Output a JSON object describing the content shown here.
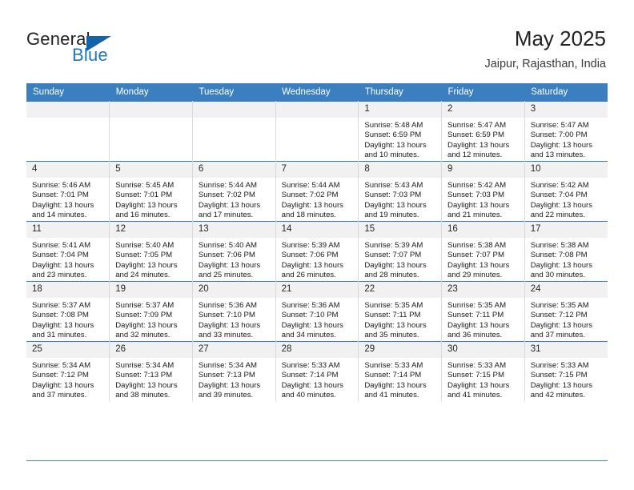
{
  "brand": {
    "name_top": "General",
    "name_bottom": "Blue",
    "accent_color": "#1263a8",
    "text_color": "#231f20"
  },
  "header": {
    "title": "May 2025",
    "subtitle": "Jaipur, Rajasthan, India"
  },
  "calendar": {
    "header_bg": "#3c7fc1",
    "header_text_color": "#ffffff",
    "daynum_bg": "#f1f1f1",
    "weekdays": [
      "Sunday",
      "Monday",
      "Tuesday",
      "Wednesday",
      "Thursday",
      "Friday",
      "Saturday"
    ],
    "weeks": [
      [
        {
          "day": "",
          "lines": []
        },
        {
          "day": "",
          "lines": []
        },
        {
          "day": "",
          "lines": []
        },
        {
          "day": "",
          "lines": []
        },
        {
          "day": "1",
          "lines": [
            "Sunrise: 5:48 AM",
            "Sunset: 6:59 PM",
            "Daylight: 13 hours and 10 minutes."
          ]
        },
        {
          "day": "2",
          "lines": [
            "Sunrise: 5:47 AM",
            "Sunset: 6:59 PM",
            "Daylight: 13 hours and 12 minutes."
          ]
        },
        {
          "day": "3",
          "lines": [
            "Sunrise: 5:47 AM",
            "Sunset: 7:00 PM",
            "Daylight: 13 hours and 13 minutes."
          ]
        }
      ],
      [
        {
          "day": "4",
          "lines": [
            "Sunrise: 5:46 AM",
            "Sunset: 7:01 PM",
            "Daylight: 13 hours and 14 minutes."
          ]
        },
        {
          "day": "5",
          "lines": [
            "Sunrise: 5:45 AM",
            "Sunset: 7:01 PM",
            "Daylight: 13 hours and 16 minutes."
          ]
        },
        {
          "day": "6",
          "lines": [
            "Sunrise: 5:44 AM",
            "Sunset: 7:02 PM",
            "Daylight: 13 hours and 17 minutes."
          ]
        },
        {
          "day": "7",
          "lines": [
            "Sunrise: 5:44 AM",
            "Sunset: 7:02 PM",
            "Daylight: 13 hours and 18 minutes."
          ]
        },
        {
          "day": "8",
          "lines": [
            "Sunrise: 5:43 AM",
            "Sunset: 7:03 PM",
            "Daylight: 13 hours and 19 minutes."
          ]
        },
        {
          "day": "9",
          "lines": [
            "Sunrise: 5:42 AM",
            "Sunset: 7:03 PM",
            "Daylight: 13 hours and 21 minutes."
          ]
        },
        {
          "day": "10",
          "lines": [
            "Sunrise: 5:42 AM",
            "Sunset: 7:04 PM",
            "Daylight: 13 hours and 22 minutes."
          ]
        }
      ],
      [
        {
          "day": "11",
          "lines": [
            "Sunrise: 5:41 AM",
            "Sunset: 7:04 PM",
            "Daylight: 13 hours and 23 minutes."
          ]
        },
        {
          "day": "12",
          "lines": [
            "Sunrise: 5:40 AM",
            "Sunset: 7:05 PM",
            "Daylight: 13 hours and 24 minutes."
          ]
        },
        {
          "day": "13",
          "lines": [
            "Sunrise: 5:40 AM",
            "Sunset: 7:06 PM",
            "Daylight: 13 hours and 25 minutes."
          ]
        },
        {
          "day": "14",
          "lines": [
            "Sunrise: 5:39 AM",
            "Sunset: 7:06 PM",
            "Daylight: 13 hours and 26 minutes."
          ]
        },
        {
          "day": "15",
          "lines": [
            "Sunrise: 5:39 AM",
            "Sunset: 7:07 PM",
            "Daylight: 13 hours and 28 minutes."
          ]
        },
        {
          "day": "16",
          "lines": [
            "Sunrise: 5:38 AM",
            "Sunset: 7:07 PM",
            "Daylight: 13 hours and 29 minutes."
          ]
        },
        {
          "day": "17",
          "lines": [
            "Sunrise: 5:38 AM",
            "Sunset: 7:08 PM",
            "Daylight: 13 hours and 30 minutes."
          ]
        }
      ],
      [
        {
          "day": "18",
          "lines": [
            "Sunrise: 5:37 AM",
            "Sunset: 7:08 PM",
            "Daylight: 13 hours and 31 minutes."
          ]
        },
        {
          "day": "19",
          "lines": [
            "Sunrise: 5:37 AM",
            "Sunset: 7:09 PM",
            "Daylight: 13 hours and 32 minutes."
          ]
        },
        {
          "day": "20",
          "lines": [
            "Sunrise: 5:36 AM",
            "Sunset: 7:10 PM",
            "Daylight: 13 hours and 33 minutes."
          ]
        },
        {
          "day": "21",
          "lines": [
            "Sunrise: 5:36 AM",
            "Sunset: 7:10 PM",
            "Daylight: 13 hours and 34 minutes."
          ]
        },
        {
          "day": "22",
          "lines": [
            "Sunrise: 5:35 AM",
            "Sunset: 7:11 PM",
            "Daylight: 13 hours and 35 minutes."
          ]
        },
        {
          "day": "23",
          "lines": [
            "Sunrise: 5:35 AM",
            "Sunset: 7:11 PM",
            "Daylight: 13 hours and 36 minutes."
          ]
        },
        {
          "day": "24",
          "lines": [
            "Sunrise: 5:35 AM",
            "Sunset: 7:12 PM",
            "Daylight: 13 hours and 37 minutes."
          ]
        }
      ],
      [
        {
          "day": "25",
          "lines": [
            "Sunrise: 5:34 AM",
            "Sunset: 7:12 PM",
            "Daylight: 13 hours and 37 minutes."
          ]
        },
        {
          "day": "26",
          "lines": [
            "Sunrise: 5:34 AM",
            "Sunset: 7:13 PM",
            "Daylight: 13 hours and 38 minutes."
          ]
        },
        {
          "day": "27",
          "lines": [
            "Sunrise: 5:34 AM",
            "Sunset: 7:13 PM",
            "Daylight: 13 hours and 39 minutes."
          ]
        },
        {
          "day": "28",
          "lines": [
            "Sunrise: 5:33 AM",
            "Sunset: 7:14 PM",
            "Daylight: 13 hours and 40 minutes."
          ]
        },
        {
          "day": "29",
          "lines": [
            "Sunrise: 5:33 AM",
            "Sunset: 7:14 PM",
            "Daylight: 13 hours and 41 minutes."
          ]
        },
        {
          "day": "30",
          "lines": [
            "Sunrise: 5:33 AM",
            "Sunset: 7:15 PM",
            "Daylight: 13 hours and 41 minutes."
          ]
        },
        {
          "day": "31",
          "lines": [
            "Sunrise: 5:33 AM",
            "Sunset: 7:15 PM",
            "Daylight: 13 hours and 42 minutes."
          ]
        }
      ]
    ]
  }
}
